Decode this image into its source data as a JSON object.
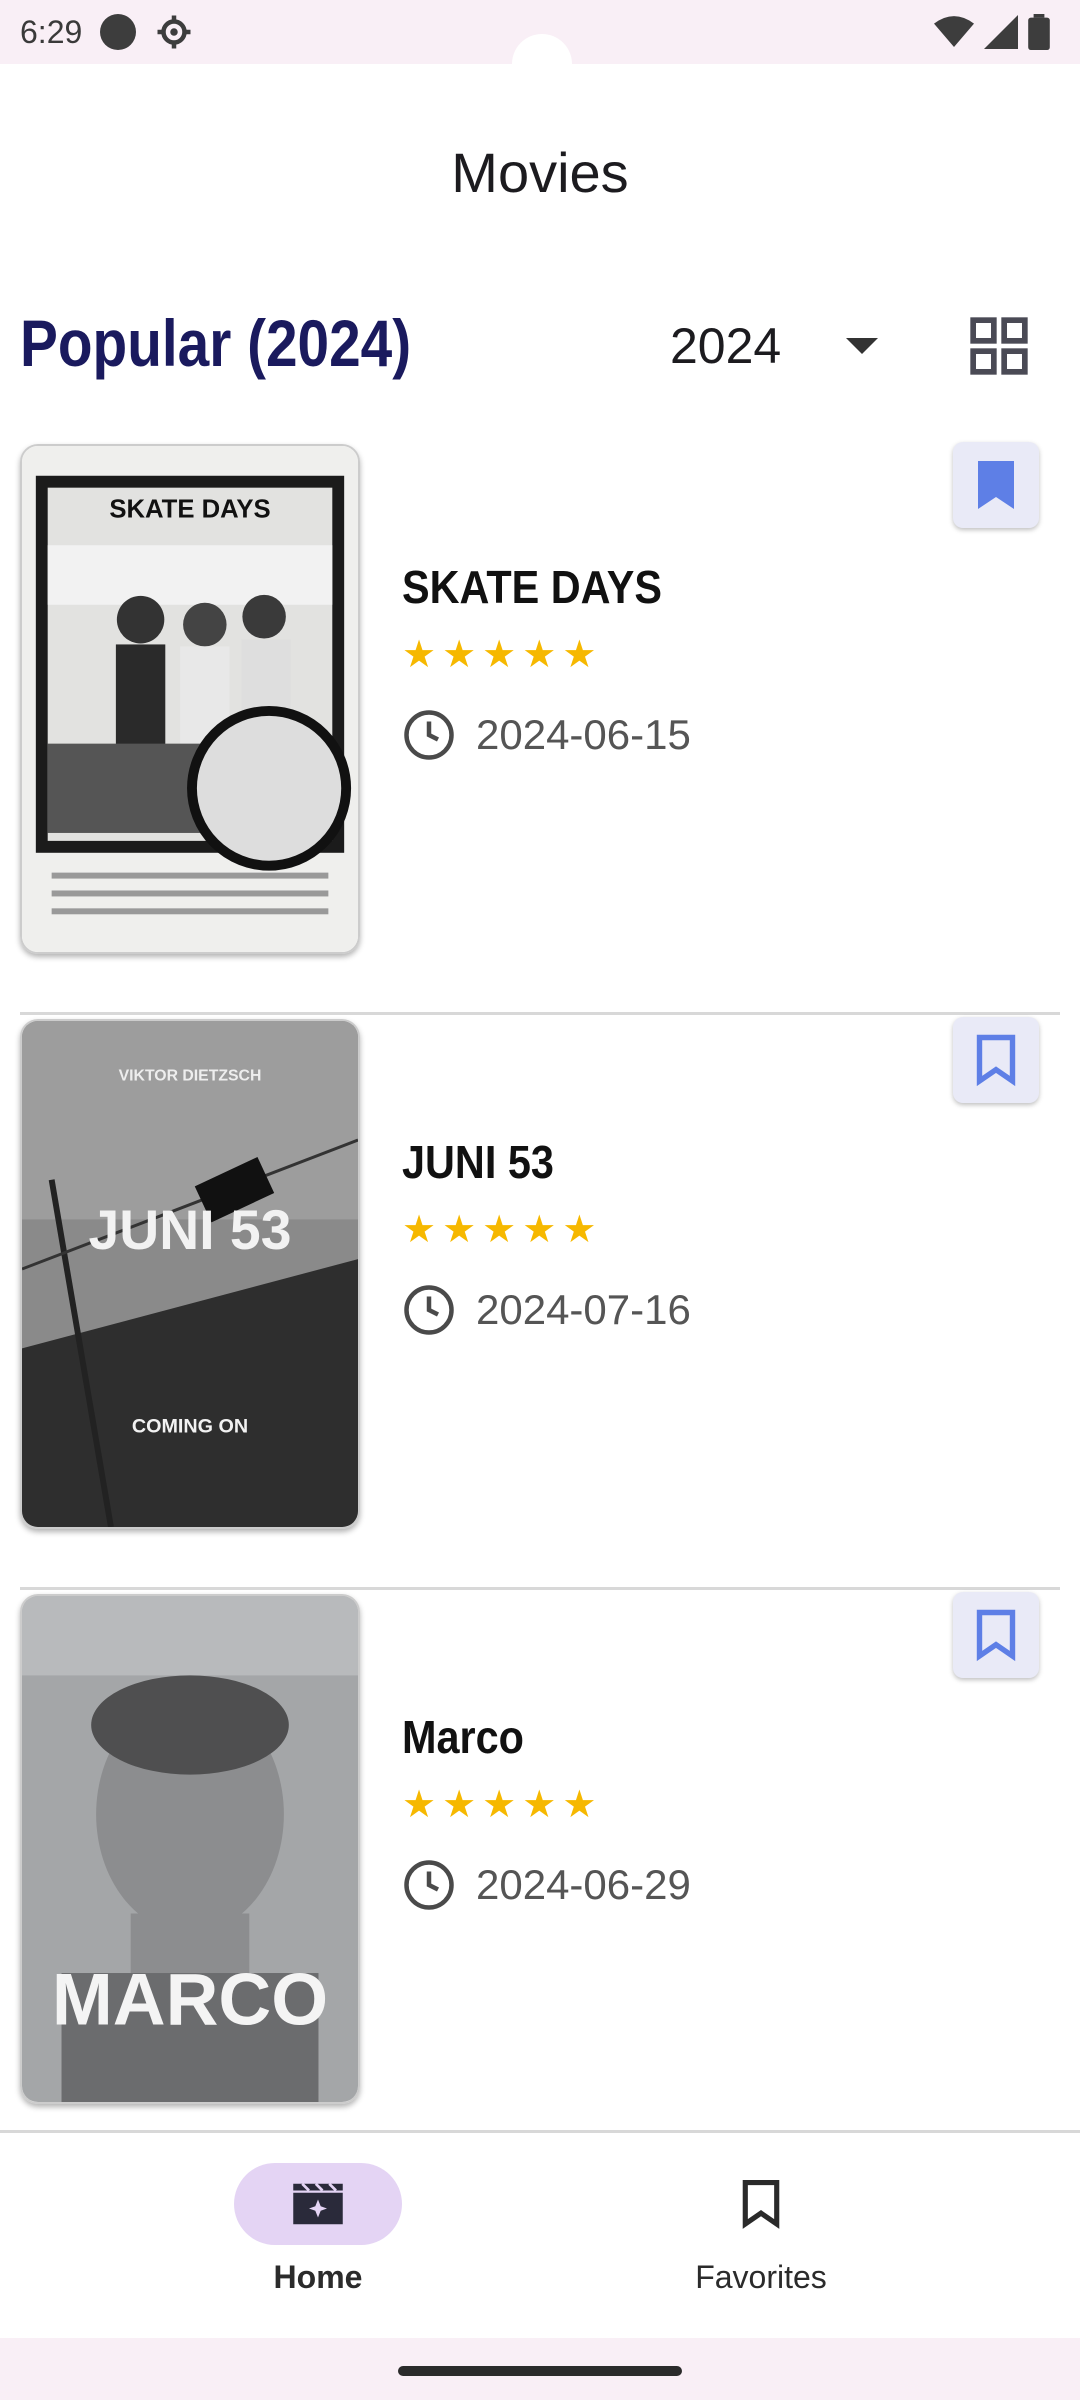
{
  "status_bar": {
    "time": "6:29"
  },
  "app_bar": {
    "title": "Movies"
  },
  "section": {
    "title": "Popular (2024)",
    "year_selected": "2024"
  },
  "movies": [
    {
      "title": "SKATE DAYS",
      "rating": 5,
      "date": "2024-06-15",
      "favorited": true,
      "poster_text": "SKATE DAYS"
    },
    {
      "title": "JUNI 53",
      "rating": 5,
      "date": "2024-07-16",
      "favorited": false,
      "poster_text": "JUNI 53",
      "poster_top": "VIKTOR DIETZSCH",
      "poster_bottom": "COMING ON"
    },
    {
      "title": "Marco",
      "rating": 5,
      "date": "2024-06-29",
      "favorited": false,
      "poster_text": "MARCO"
    }
  ],
  "bottom_nav": {
    "home_label": "Home",
    "favorites_label": "Favorites"
  },
  "colors": {
    "accent": "#1a1a5e",
    "star": "#f6b800",
    "bookmark": "#5e7fe6",
    "nav_pill": "#e4d4f4"
  }
}
